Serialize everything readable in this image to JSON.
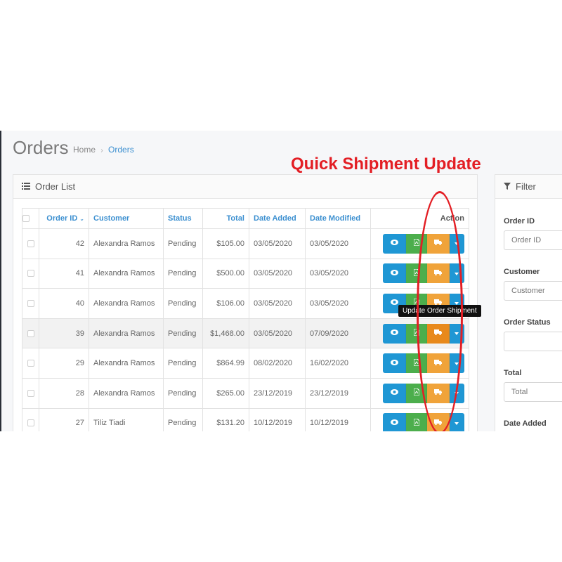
{
  "page": {
    "title": "Orders"
  },
  "breadcrumb": {
    "home": "Home",
    "sep": "›",
    "current": "Orders"
  },
  "annotation": {
    "label": "Quick Shipment Update",
    "color": "#e31e24"
  },
  "order_list": {
    "heading": "Order List",
    "heading_icon": "list-icon",
    "columns": {
      "order_id": "Order ID",
      "customer": "Customer",
      "status": "Status",
      "total": "Total",
      "date_added": "Date Added",
      "date_modified": "Date Modified",
      "action": "Action"
    },
    "sort_caret": "⌄",
    "rows": [
      {
        "id": "42",
        "customer": "Alexandra Ramos",
        "status": "Pending",
        "total": "$105.00",
        "date_added": "03/05/2020",
        "date_modified": "03/05/2020"
      },
      {
        "id": "41",
        "customer": "Alexandra Ramos",
        "status": "Pending",
        "total": "$500.00",
        "date_added": "03/05/2020",
        "date_modified": "03/05/2020"
      },
      {
        "id": "40",
        "customer": "Alexandra Ramos",
        "status": "Pending",
        "total": "$106.00",
        "date_added": "03/05/2020",
        "date_modified": "03/05/2020"
      },
      {
        "id": "39",
        "customer": "Alexandra Ramos",
        "status": "Pending",
        "total": "$1,468.00",
        "date_added": "03/05/2020",
        "date_modified": "07/09/2020"
      },
      {
        "id": "29",
        "customer": "Alexandra Ramos",
        "status": "Pending",
        "total": "$864.99",
        "date_added": "08/02/2020",
        "date_modified": "16/02/2020"
      },
      {
        "id": "28",
        "customer": "Alexandra Ramos",
        "status": "Pending",
        "total": "$265.00",
        "date_added": "23/12/2019",
        "date_modified": "23/12/2019"
      },
      {
        "id": "27",
        "customer": "Tiliz Tiadi",
        "status": "Pending",
        "total": "$131.20",
        "date_added": "10/12/2019",
        "date_modified": "10/12/2019"
      }
    ],
    "tooltip": "Update Order Shipment",
    "colors": {
      "view": "#1f97d4",
      "pdf": "#4cae4c",
      "ship": "#f0a33a",
      "link": "#3b8fd0"
    }
  },
  "filter": {
    "heading": "Filter",
    "heading_icon": "filter-icon",
    "fields": {
      "order_id": {
        "label": "Order ID",
        "placeholder": "Order ID"
      },
      "customer": {
        "label": "Customer",
        "placeholder": "Customer"
      },
      "order_status": {
        "label": "Order Status",
        "placeholder": ""
      },
      "total": {
        "label": "Total",
        "placeholder": "Total"
      },
      "date_added": {
        "label": "Date Added"
      }
    }
  }
}
